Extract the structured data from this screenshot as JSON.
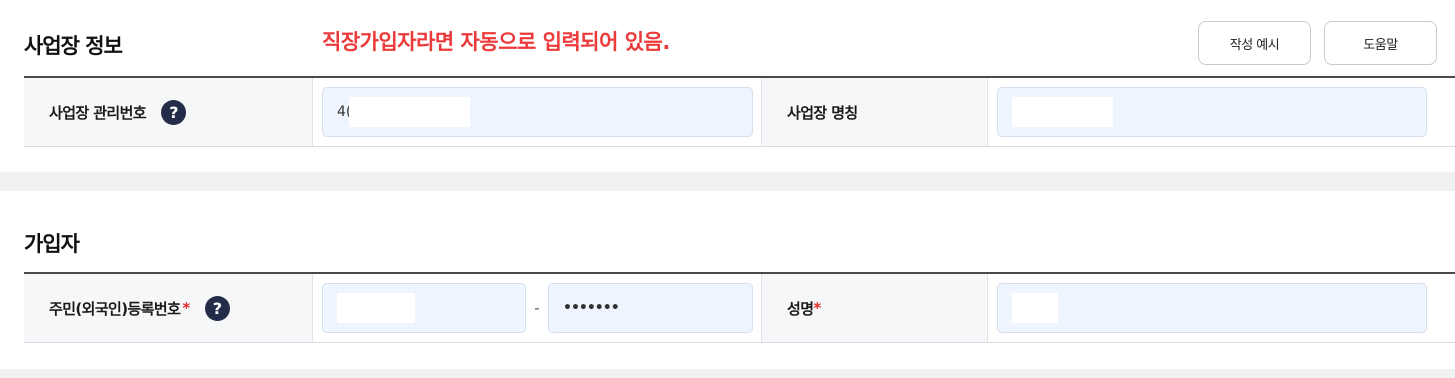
{
  "business_section": {
    "title": "사업장 정보",
    "notice": "직장가입자라면 자동으로 입력되어 있음.",
    "example_button": "작성 예시",
    "help_button": "도움말",
    "mgmt_number_label": "사업장 관리번호",
    "mgmt_number_value": "4(",
    "business_name_label": "사업장 명칭",
    "business_name_value": "",
    "help_icon": "question-icon"
  },
  "subscriber_section": {
    "title": "가입자",
    "resident_number_label": "주민(외국인)등록번호",
    "required_mark": "*",
    "resident_front_value": "",
    "separator": "-",
    "resident_back_value": "•••••••",
    "name_label": "성명",
    "name_value": ""
  },
  "colors": {
    "notice": "#ec3a3a",
    "input_bg": "#eef5fe",
    "help_icon_bg": "#232c48",
    "required": "#e32b2b"
  }
}
